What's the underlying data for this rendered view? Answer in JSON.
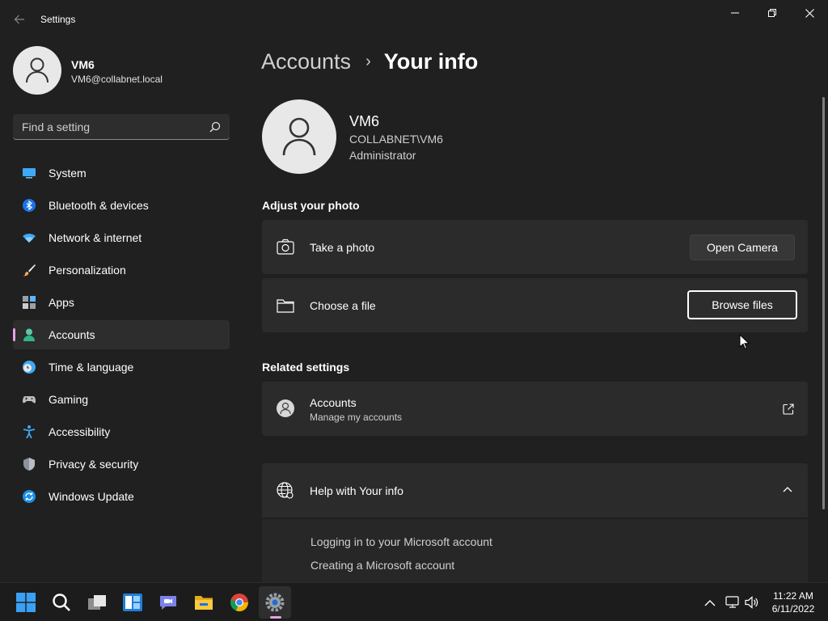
{
  "window": {
    "title": "Settings",
    "back_icon": "back-arrow-icon",
    "minimize_icon": "minimize-icon",
    "maximize_icon": "restore-icon",
    "close_icon": "close-icon"
  },
  "profile": {
    "name": "VM6",
    "email": "VM6@collabnet.local",
    "avatar_icon": "person-icon"
  },
  "search": {
    "placeholder": "Find a setting",
    "value": "",
    "icon": "search-icon"
  },
  "sidebar": {
    "items": [
      {
        "label": "System",
        "icon": "monitor-icon"
      },
      {
        "label": "Bluetooth & devices",
        "icon": "bluetooth-icon"
      },
      {
        "label": "Network & internet",
        "icon": "wifi-icon"
      },
      {
        "label": "Personalization",
        "icon": "brush-icon"
      },
      {
        "label": "Apps",
        "icon": "apps-icon"
      },
      {
        "label": "Accounts",
        "icon": "account-icon",
        "active": true
      },
      {
        "label": "Time & language",
        "icon": "clock-globe-icon"
      },
      {
        "label": "Gaming",
        "icon": "gamepad-icon"
      },
      {
        "label": "Accessibility",
        "icon": "accessibility-icon"
      },
      {
        "label": "Privacy & security",
        "icon": "shield-icon"
      },
      {
        "label": "Windows Update",
        "icon": "update-icon"
      }
    ],
    "active_accent": "#e6a1e6"
  },
  "breadcrumb": {
    "parent": "Accounts",
    "separator": "›",
    "current": "Your info"
  },
  "user": {
    "name": "VM6",
    "domain": "COLLABNET\\VM6",
    "role": "Administrator"
  },
  "adjust_photo": {
    "title": "Adjust your photo",
    "take_photo": {
      "label": "Take a photo",
      "button": "Open Camera",
      "icon": "camera-icon"
    },
    "choose_file": {
      "label": "Choose a file",
      "button": "Browse files",
      "icon": "folder-icon"
    }
  },
  "related": {
    "title": "Related settings",
    "accounts": {
      "label": "Accounts",
      "sublabel": "Manage my accounts",
      "icon": "person-circle-icon",
      "action_icon": "external-link-icon"
    }
  },
  "help": {
    "title": "Help with Your info",
    "icon": "globe-icon",
    "toggle_icon": "chevron-up-icon",
    "links": [
      "Logging in to your Microsoft account",
      "Creating a Microsoft account"
    ]
  },
  "taskbar": {
    "apps": [
      "windows-start-icon",
      "search-icon",
      "task-view-icon",
      "widgets-icon",
      "teams-chat-icon",
      "file-explorer-icon",
      "chrome-icon",
      "settings-gear-icon"
    ],
    "tray": [
      "chevron-up-icon",
      "network-icon",
      "volume-icon"
    ],
    "time": "11:22 AM",
    "date": "6/11/2022"
  },
  "colors": {
    "background": "#202020",
    "card": "#2b2b2b",
    "accent": "#e6a1e6"
  }
}
